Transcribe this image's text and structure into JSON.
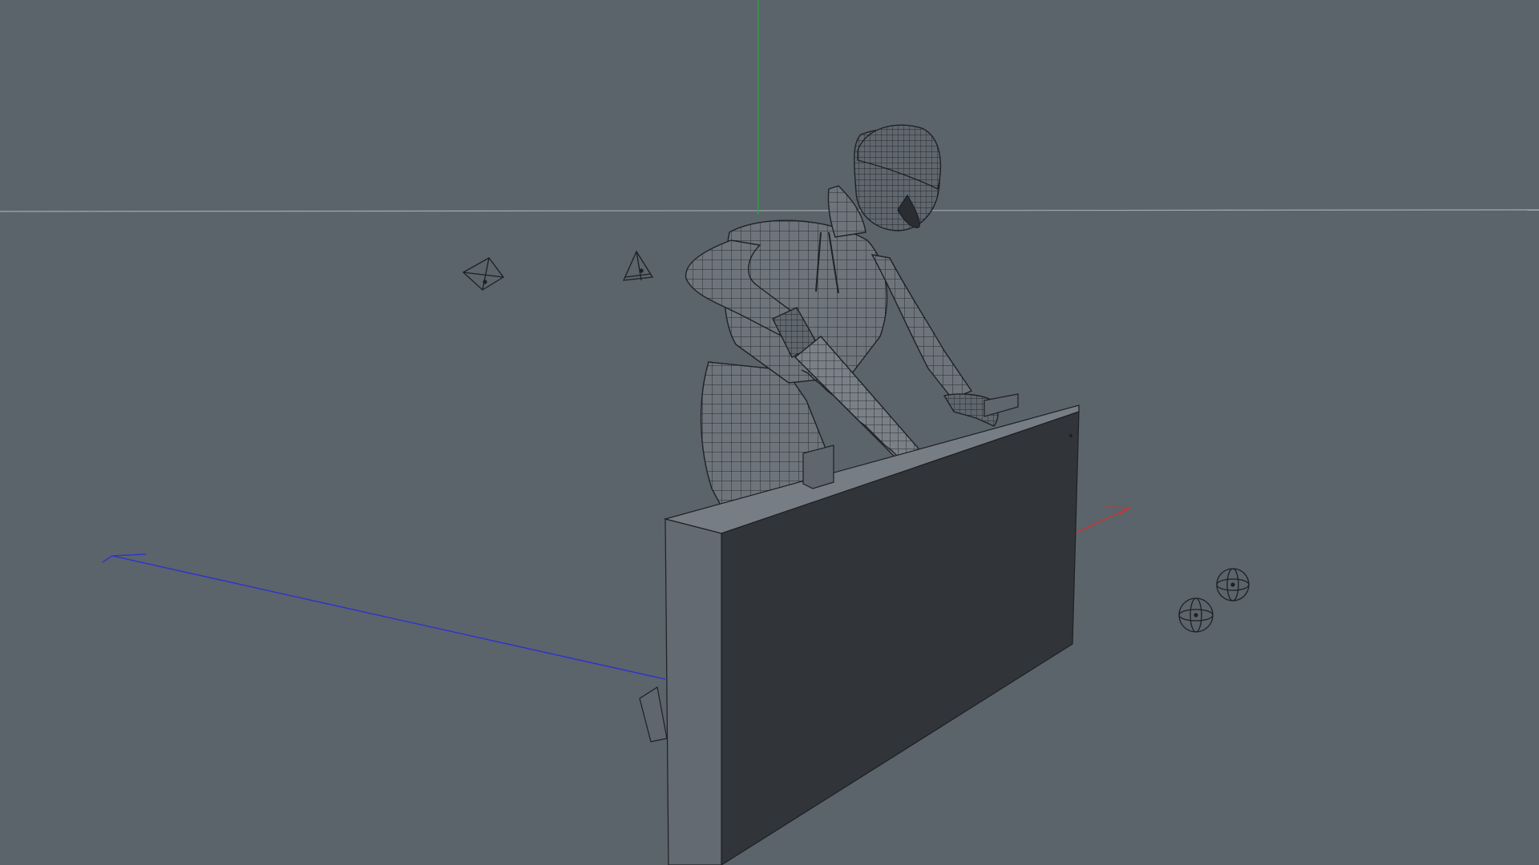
{
  "viewport": {
    "background_color": "#5b636b",
    "shading_mode": "wireframe-on-shaded"
  },
  "axes": {
    "x_color": "#d2322d",
    "y_color": "#2fa13e",
    "z_color": "#2a2fd8",
    "grid_line_color": "#9aa0a6"
  },
  "scene_objects": [
    {
      "name": "worker-figure",
      "kind": "mesh"
    },
    {
      "name": "hand-saw",
      "kind": "mesh"
    },
    {
      "name": "plank-board",
      "kind": "mesh"
    },
    {
      "name": "camera-gizmo-1",
      "kind": "camera"
    },
    {
      "name": "camera-gizmo-2",
      "kind": "camera"
    },
    {
      "name": "light-gizmo-1",
      "kind": "light"
    },
    {
      "name": "light-gizmo-2",
      "kind": "light"
    }
  ]
}
